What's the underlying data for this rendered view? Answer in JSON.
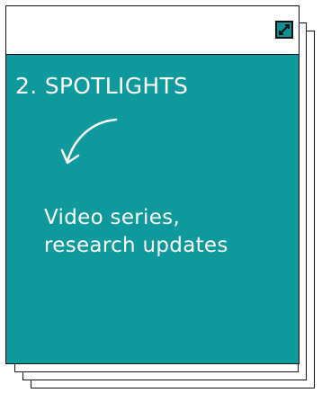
{
  "card": {
    "title": "2. SPOTLIGHTS",
    "description_lines": [
      "Video series,",
      "research updates"
    ],
    "icons": {
      "expand": "expand-diagonal-arrows-icon",
      "pointer": "curved-arrow-down-left-icon"
    },
    "colors": {
      "body": "#0e9a9d",
      "expand_button": "#0e8f92",
      "text": "#ffffff",
      "outline": "#111111"
    }
  }
}
